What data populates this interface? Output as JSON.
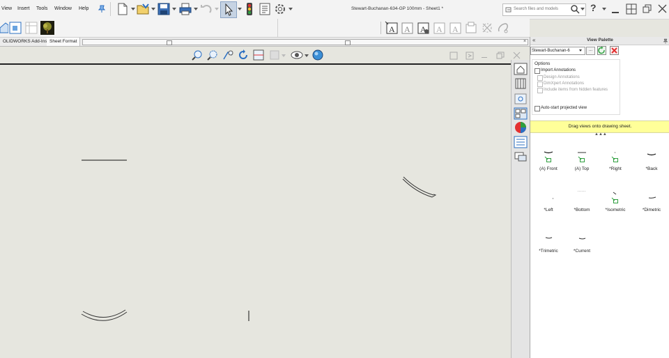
{
  "menu": {
    "items": [
      "View",
      "Insert",
      "Tools",
      "Window",
      "Help"
    ]
  },
  "window": {
    "title": "Stewart-Buchanan-634-GP 100mm - Sheet1 *"
  },
  "search": {
    "placeholder": "Search files and models"
  },
  "tabs": {
    "addins": "OLIDWORKS Add-Ins",
    "sheet_format": "Sheet Format"
  },
  "palette": {
    "title": "View Palette",
    "document": "Stewart-Buchanan-6",
    "options_label": "Options",
    "import_annotations": "Import Annotations",
    "design_annotations": "Design Annotations",
    "dimxpert_annotations": "DimXpert Annotations",
    "hidden_features": "Include items from hidden features",
    "auto_start": "Auto-start projected view",
    "banner": "Drag views onto drawing sheet.",
    "views": [
      {
        "label": "(A) Front"
      },
      {
        "label": "(A) Top"
      },
      {
        "label": "*Right"
      },
      {
        "label": "*Back"
      },
      {
        "label": "*Left"
      },
      {
        "label": "*Bottom"
      },
      {
        "label": "*Isometric"
      },
      {
        "label": "*Dimetric"
      },
      {
        "label": "*Trimetric"
      },
      {
        "label": "*Current"
      }
    ]
  },
  "colors": {
    "banner": "#ffff99",
    "canvas": "#e6e6df",
    "close_red": "#e23030",
    "refresh_green": "#2e9e3e"
  }
}
